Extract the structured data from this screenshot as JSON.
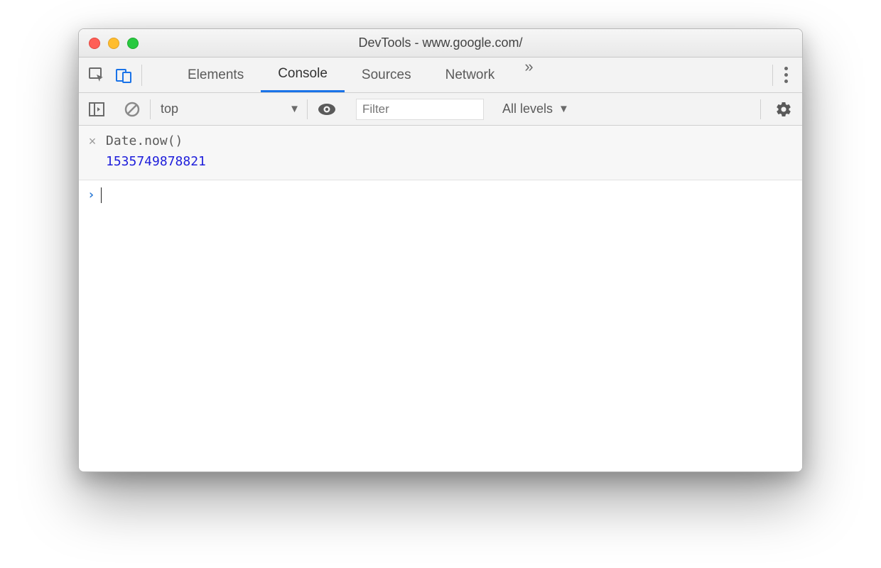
{
  "window": {
    "title": "DevTools - www.google.com/"
  },
  "tabs": {
    "items": [
      "Elements",
      "Console",
      "Sources",
      "Network"
    ],
    "active": "Console",
    "overflow_glyph": "»"
  },
  "toolbar": {
    "context": "top",
    "filter_placeholder": "Filter",
    "levels_label": "All levels"
  },
  "console": {
    "history": {
      "input": "Date.now()",
      "result": "1535749878821"
    }
  }
}
